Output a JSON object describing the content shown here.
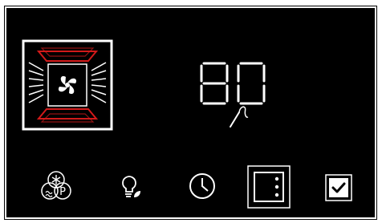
{
  "display": {
    "value": "80"
  },
  "icons": {
    "oven": "oven-fan-icon",
    "probe": "meat-probe-icon",
    "mode": "snowflake-steam-p-icon",
    "light": "lightbulb-leaf-icon",
    "timer": "clock-icon",
    "oven_select": "oven-select-icon",
    "confirm": "checkbox-icon"
  },
  "colors": {
    "background": "#000000",
    "foreground": "#ffffff",
    "accent": "#d21a1a"
  }
}
